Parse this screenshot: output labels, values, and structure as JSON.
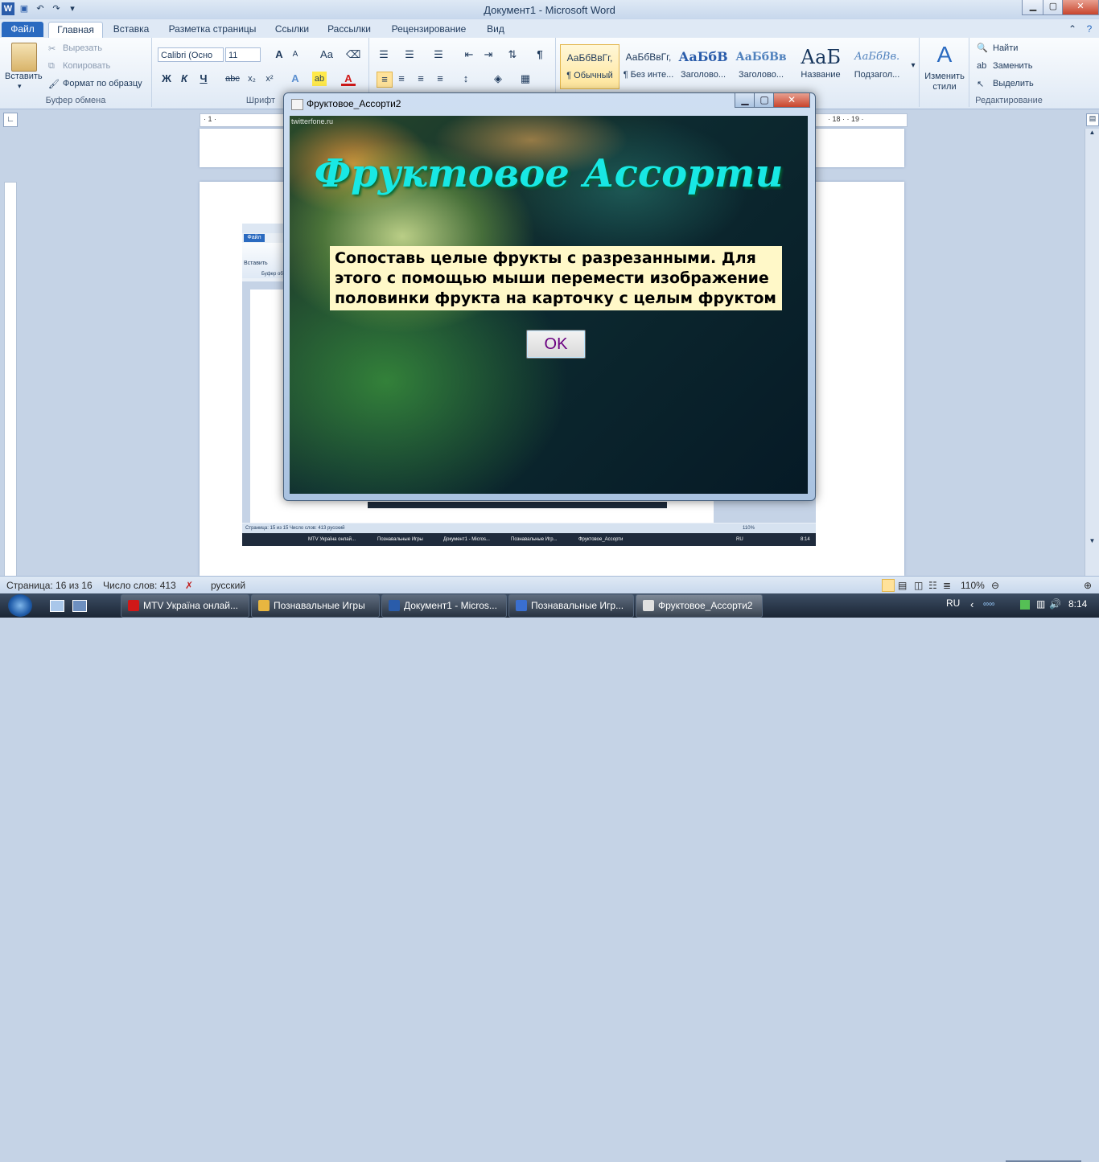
{
  "window": {
    "title": "Документ1 - Microsoft Word",
    "minimize": "▁",
    "maximize": "▢",
    "close": "✕"
  },
  "tabs": {
    "file": "Файл",
    "home": "Главная",
    "insert": "Вставка",
    "page_layout": "Разметка страницы",
    "references": "Ссылки",
    "mailings": "Рассылки",
    "review": "Рецензирование",
    "view": "Вид"
  },
  "clipboard": {
    "paste": "Вставить",
    "cut": "Вырезать",
    "copy": "Копировать",
    "format_painter": "Формат по образцу",
    "group": "Буфер обмена"
  },
  "font": {
    "name": "Calibri (Осно",
    "size": "11",
    "group": "Шрифт",
    "bold": "Ж",
    "italic": "К",
    "underline": "Ч",
    "strike": "abc",
    "grow": "A",
    "shrink": "A",
    "case": "Aa"
  },
  "styles": [
    {
      "sample": "АаБбВвГг,",
      "name": "¶ Обычный"
    },
    {
      "sample": "АаБбВвГг,",
      "name": "¶ Без инте..."
    },
    {
      "sample": "АаБбВ",
      "name": "Заголово..."
    },
    {
      "sample": "АаБбВв",
      "name": "Заголово..."
    },
    {
      "sample": "АаБ",
      "name": "Название"
    },
    {
      "sample": "АаБбВв.",
      "name": "Подзагол..."
    }
  ],
  "change_styles": "Изменить стили",
  "editing": {
    "find": "Найти",
    "replace": "Заменить",
    "select": "Выделить",
    "group": "Редактирование"
  },
  "ruler": {
    "left_marks": "· 1 · ",
    "right_marks": "· 18 · · 19 ·"
  },
  "dialog": {
    "title": "Фруктовое_Ассорти2",
    "watermark": "twitterfone.ru",
    "heading": "Фруктовое Ассорти",
    "message": "Сопоставь целые фрукты с разрезанными. Для этого с помощью мыши перемести изображение половинки фрукта на карточку с целым фруктом",
    "ok": "OK"
  },
  "statusbar": {
    "page": "Страница: 16 из 16",
    "words": "Число слов: 413",
    "language": "русский",
    "zoom": "110%"
  },
  "taskbar": {
    "items": [
      {
        "label": "MTV Україна онлай...",
        "color": "#d01818"
      },
      {
        "label": "Познавальные Игры",
        "color": "#e8b640"
      },
      {
        "label": "Документ1 - Micros...",
        "color": "#2a5caa"
      },
      {
        "label": "Познавальные Игр...",
        "color": "#3a6fd0"
      },
      {
        "label": "Фруктовое_Ассорти2",
        "color": "#e0e0e0"
      }
    ],
    "lang": "RU",
    "time": "8:14"
  },
  "nested": {
    "file_tab": "Файл",
    "paste": "Вставить",
    "group": "Буфер обм",
    "status": "Страница: 15 из 15   Число слов: 413   русский",
    "task1": "MTV Україна онлай...",
    "task2": "Познавальные Игры",
    "task3": "Документ1 - Micros...",
    "task4": "Познавальные Игр...",
    "task5": "Фруктовое_Ассорти",
    "lang": "RU",
    "time": "8:14",
    "zoom": "110%"
  }
}
